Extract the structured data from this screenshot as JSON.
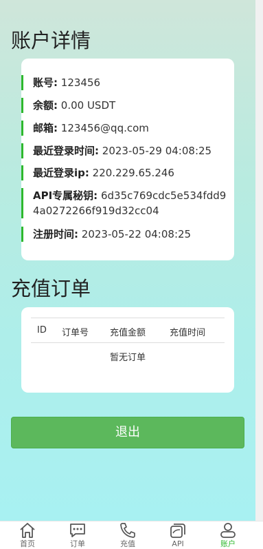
{
  "account": {
    "title": "账户详情",
    "rows": [
      {
        "label": "账号:",
        "value": "123456"
      },
      {
        "label": "余额:",
        "value": "0.00 USDT"
      },
      {
        "label": "邮箱:",
        "value": "123456@qq.com"
      },
      {
        "label": "最近登录时间:",
        "value": "2023-05-29 04:08:25"
      },
      {
        "label": "最近登录ip:",
        "value": "220.229.65.246"
      },
      {
        "label": "API专属秘钥:",
        "value": "6d35c769cdc5e534fdd9",
        "value2": "4a0272266f919d32cc04"
      },
      {
        "label": "注册时间:",
        "value": "2023-05-22 04:08:25"
      }
    ]
  },
  "orders": {
    "title": "充值订单",
    "columns": [
      "ID",
      "订单号",
      "充值金额",
      "充值时间"
    ],
    "empty_text": "暂无订单"
  },
  "logout_label": "退出",
  "tabbar": {
    "items": [
      {
        "label": "首页",
        "icon": "home-icon"
      },
      {
        "label": "订单",
        "icon": "message-icon"
      },
      {
        "label": "充值",
        "icon": "phone-icon"
      },
      {
        "label": "API",
        "icon": "cards-icon"
      },
      {
        "label": "账户",
        "icon": "user-icon",
        "active": true
      }
    ],
    "active_color": "#2eb82e"
  }
}
